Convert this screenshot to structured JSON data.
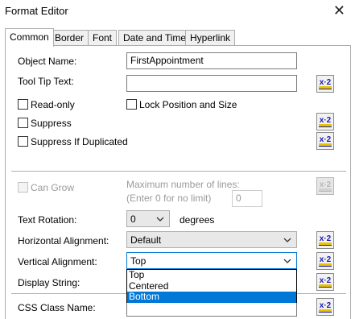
{
  "window": {
    "title": "Format Editor"
  },
  "tabs": [
    "Common",
    "Border",
    "Font",
    "Date and Time",
    "Hyperlink"
  ],
  "fields": {
    "object_name_label": "Object Name:",
    "object_name_value": "FirstAppointment",
    "tooltip_label": "Tool Tip Text:",
    "tooltip_value": "",
    "readonly_label": "Read-only",
    "lock_label": "Lock Position and Size",
    "suppress_label": "Suppress",
    "suppress_dup_label": "Suppress If Duplicated",
    "can_grow_label": "Can Grow",
    "max_lines_label1": "Maximum number of lines:",
    "max_lines_label2": "(Enter 0 for no limit)",
    "max_lines_value": "0",
    "text_rotation_label": "Text Rotation:",
    "text_rotation_value": "0",
    "degrees_label": "degrees",
    "horiz_align_label": "Horizontal Alignment:",
    "horiz_align_value": "Default",
    "vert_align_label": "Vertical Alignment:",
    "vert_align_value": "Top",
    "display_string_label": "Display String:",
    "css_class_label": "CSS Class Name:"
  },
  "vertical_alignment_options": [
    "Top",
    "Centered",
    "Bottom"
  ],
  "highlighted_option": "Bottom",
  "formula_button_label": "x·2"
}
